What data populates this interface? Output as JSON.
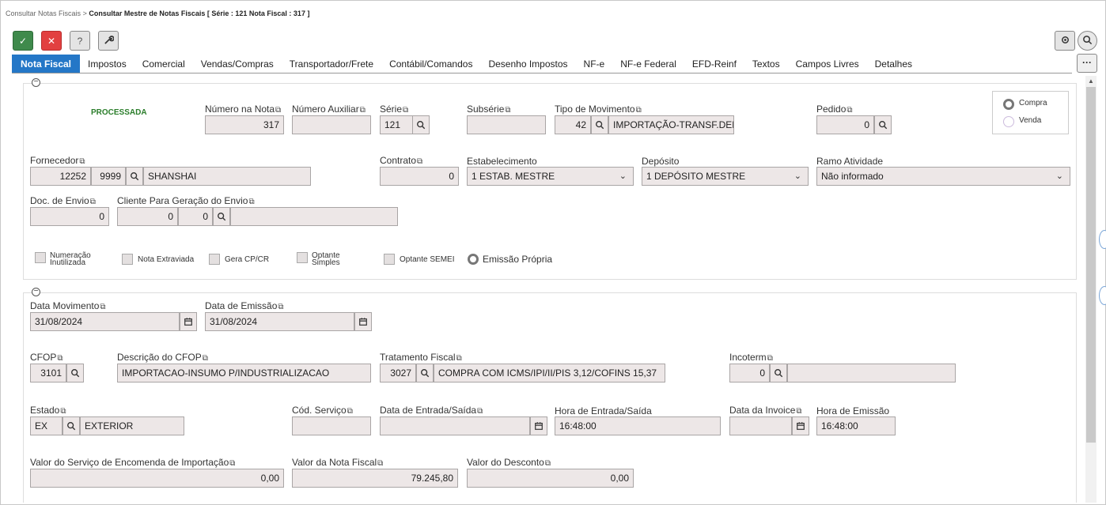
{
  "breadcrumb": {
    "parent": "Consultar Notas Fiscais",
    "sep": ">",
    "current": "Consultar Mestre de Notas Fiscais [ Série : 121 Nota Fiscal : 317 ]"
  },
  "toolbar": {
    "ok": "✓",
    "cancel": "✕",
    "help": "?",
    "tools": "🔧"
  },
  "tabs": [
    "Nota Fiscal",
    "Impostos",
    "Comercial",
    "Vendas/Compras",
    "Transportador/Frete",
    "Contábil/Comandos",
    "Desenho Impostos",
    "NF-e",
    "NF-e Federal",
    "EFD-Reinf",
    "Textos",
    "Campos Livres",
    "Detalhes"
  ],
  "more": "···",
  "s1": {
    "status": "PROCESSADA",
    "numero_label": "Número na Nota",
    "numero": "317",
    "aux_label": "Número Auxiliar",
    "aux": "",
    "serie_label": "Série",
    "serie": "121",
    "subserie_label": "Subsérie",
    "subserie": "",
    "tipo_label": "Tipo de Movimento",
    "tipo_code": "42",
    "tipo_desc": "IMPORTAÇÃO-TRANSF.DEPOSITO",
    "pedido_label": "Pedido",
    "pedido": "0",
    "radio_compra": "Compra",
    "radio_venda": "Venda",
    "forn_label": "Fornecedor",
    "forn_code": "12252",
    "forn_sub": "9999",
    "forn_name": "SHANSHAI",
    "contrato_label": "Contrato",
    "contrato": "0",
    "estab_label": "Estabelecimento",
    "estab": "1 ESTAB. MESTRE",
    "dep_label": "Depósito",
    "dep": "1 DEPÓSITO MESTRE",
    "ramo_label": "Ramo Atividade",
    "ramo": "Não informado",
    "doc_label": "Doc. de Envio",
    "doc": "0",
    "cli_label": "Cliente Para Geração do Envio",
    "cli_a": "0",
    "cli_b": "0",
    "cli_name": "",
    "c1": "Numeração Inutilizada",
    "c2": "Nota Extraviada",
    "c3": "Gera CP/CR",
    "c4": "Optante Simples",
    "c5": "Optante SEMEI",
    "emissao": "Emissão Própria"
  },
  "s2": {
    "dmov_label": "Data Movimento",
    "dmov": "31/08/2024",
    "demi_label": "Data de Emissão",
    "demi": "31/08/2024",
    "cfop_label": "CFOP",
    "cfop": "3101",
    "dcfop_label": "Descrição do CFOP",
    "dcfop": "IMPORTACAO-INSUMO P/INDUSTRIALIZACAO",
    "trat_label": "Tratamento Fiscal",
    "trat_code": "3027",
    "trat_desc": "COMPRA COM ICMS/IPI/II/PIS 3,12/COFINS 15,37",
    "inco_label": "Incoterm",
    "inco": "0",
    "inco_desc": "",
    "est_label": "Estado",
    "est": "EX",
    "est_desc": "EXTERIOR",
    "serv_label": "Cód. Serviço",
    "serv": "",
    "dent_label": "Data de Entrada/Saída",
    "dent": "",
    "hent_label": "Hora de Entrada/Saída",
    "hent": "16:48:00",
    "dinv_label": "Data da Invoice",
    "dinv": "",
    "hemi_label": "Hora de Emissão",
    "hemi": "16:48:00",
    "vserv_label": "Valor do Serviço de Encomenda de Importação",
    "vserv": "0,00",
    "vnf_label": "Valor da Nota Fiscal",
    "vnf": "79.245,80",
    "vdesc_label": "Valor do Desconto",
    "vdesc": "0,00"
  }
}
